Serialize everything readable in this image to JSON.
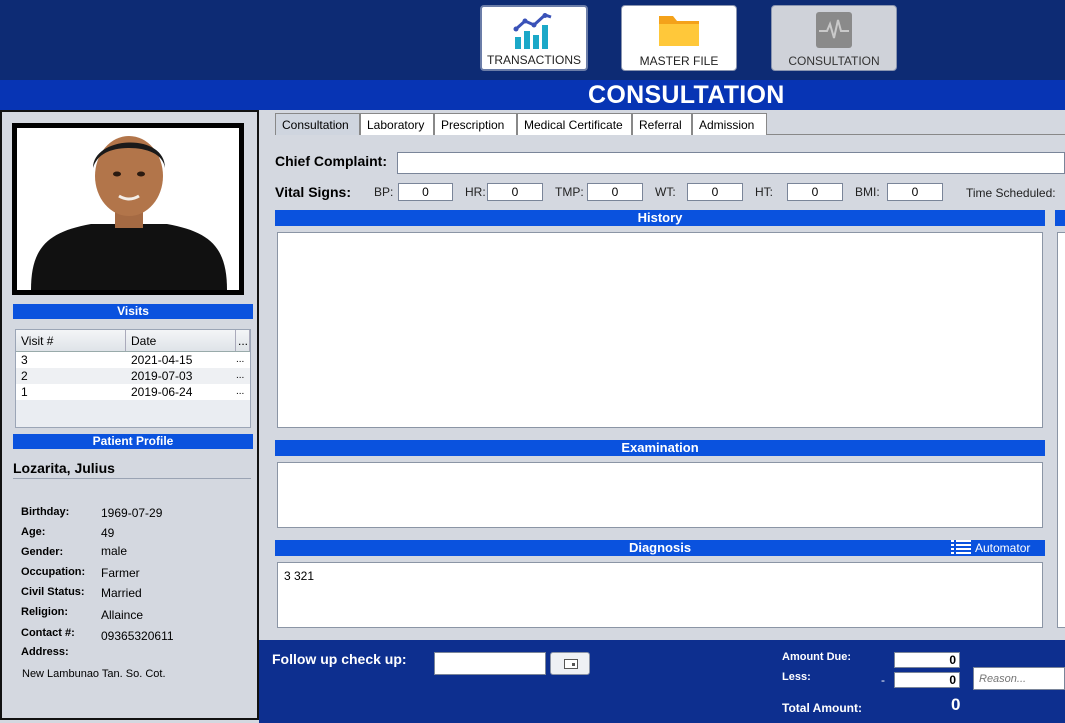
{
  "nav": {
    "transactions_label": "TRANSACTIONS",
    "masterfile_label": "MASTER FILE",
    "consultation_label": "CONSULTATION"
  },
  "page_title": "CONSULTATION",
  "visits": {
    "header": "Visits",
    "columns": [
      "Visit #",
      "Date",
      "..."
    ],
    "rows": [
      {
        "visit": "3",
        "date": "2021-04-15",
        "more": "..."
      },
      {
        "visit": "2",
        "date": "2019-07-03",
        "more": "..."
      },
      {
        "visit": "1",
        "date": "2019-06-24",
        "more": "..."
      }
    ]
  },
  "profile": {
    "header": "Patient Profile",
    "name": "Lozarita, Julius",
    "birthday_label": "Birthday:",
    "birthday": "1969-07-29",
    "age_label": "Age:",
    "age": "49",
    "gender_label": "Gender:",
    "gender": "male",
    "occupation_label": "Occupation:",
    "occupation": "Farmer",
    "civil_label": "Civil Status:",
    "civil": "Married",
    "religion_label": "Religion:",
    "religion": "Allaince",
    "contact_label": "Contact #:",
    "contact": "09365320611",
    "address_label": "Address:",
    "address": "New Lambunao Tan. So. Cot."
  },
  "tabs": [
    "Consultation",
    "Laboratory",
    "Prescription",
    "Medical Certificate",
    "Referral",
    "Admission"
  ],
  "consult": {
    "chief_label": "Chief Complaint:",
    "chief_value": "",
    "vitals_label": "Vital Signs:",
    "bp_label": "BP:",
    "bp": "0",
    "hr_label": "HR:",
    "hr": "0",
    "tmp_label": "TMP:",
    "tmp": "0",
    "wt_label": "WT:",
    "wt": "0",
    "ht_label": "HT:",
    "ht": "0",
    "bmi_label": "BMI:",
    "bmi": "0",
    "time_label": "Time Scheduled:",
    "history_label": "History",
    "history_value": "",
    "exam_label": "Examination",
    "exam_value": "",
    "diagnosis_label": "Diagnosis",
    "automator_label": "Automator",
    "diagnosis_value": "3 321"
  },
  "footer": {
    "followup_label": "Follow up check up:",
    "followup_value": "",
    "amount_due_label": "Amount Due:",
    "amount_due": "0",
    "less_label": "Less:",
    "less_dash": "-",
    "less": "0",
    "reason_placeholder": "Reason...",
    "total_label": "Total Amount:",
    "total": "0"
  },
  "colors": {
    "nav_bg": "#0d2b74",
    "accent": "#0a52de",
    "title_bar": "#0734b4"
  }
}
